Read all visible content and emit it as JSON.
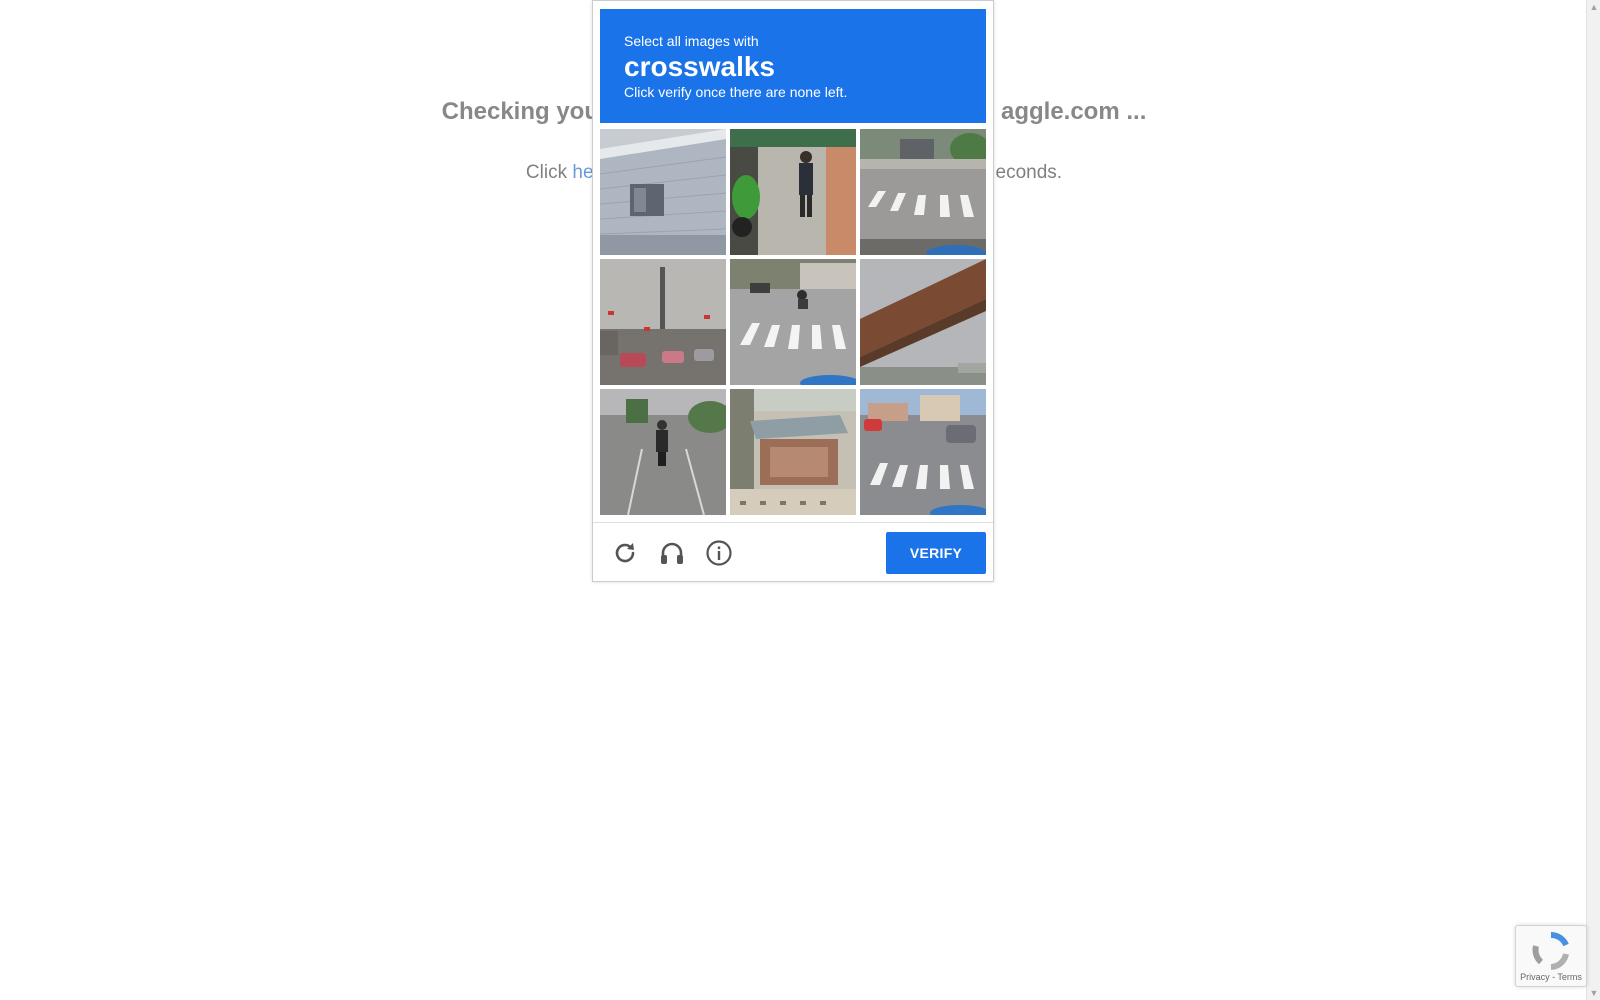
{
  "background": {
    "heading_left": "Checking you",
    "heading_right": "aggle.com ...",
    "sub_prefix": "Click",
    "sub_link": "he",
    "sub_suffix": "econds."
  },
  "challenge": {
    "instruction": "Select all images with",
    "target": "crosswalks",
    "hint": "Click verify once there are none left.",
    "accent_color": "#1a73e8",
    "tiles": [
      {
        "scene": "building-facade"
      },
      {
        "scene": "person-walking-with-motorcycle"
      },
      {
        "scene": "crosswalk-street"
      },
      {
        "scene": "traffic-lights-road"
      },
      {
        "scene": "crosswalk-with-scooter"
      },
      {
        "scene": "railway-bridge"
      },
      {
        "scene": "scooter-on-road"
      },
      {
        "scene": "roadside-kiosk"
      },
      {
        "scene": "crosswalk-with-cars"
      }
    ],
    "footer": {
      "reload_icon": "reload-icon",
      "audio_icon": "headphones-icon",
      "info_icon": "info-icon",
      "verify_label": "VERIFY"
    }
  },
  "badge": {
    "links": "Privacy - Terms"
  }
}
